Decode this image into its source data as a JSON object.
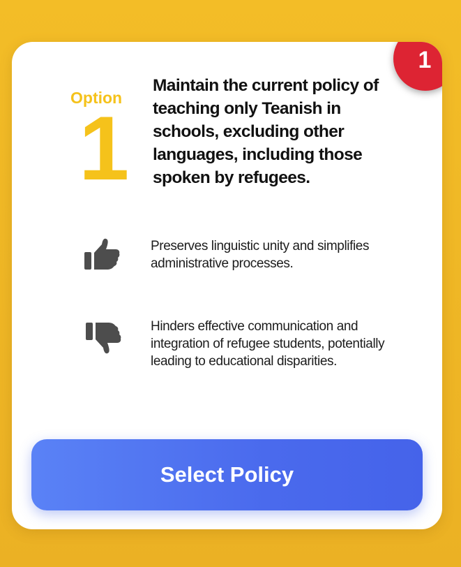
{
  "option": {
    "label": "Option",
    "number": "1",
    "title": "Maintain the current policy of teaching only Teanish in schools, excluding other languages, including those spoken by refugees."
  },
  "badge": {
    "number": "1",
    "color": "#dd2433"
  },
  "pros": {
    "icon": "thumbs-up-icon",
    "text": "Preserves linguistic unity and simplifies administrative processes."
  },
  "cons": {
    "icon": "thumbs-down-icon",
    "text": "Hinders effective communication and integration of refugee students, potentially leading to educational disparities."
  },
  "action": {
    "select_label": "Select Policy",
    "color": "#4a6aed"
  },
  "colors": {
    "background": "#f0b725",
    "accent": "#f5c21b"
  }
}
